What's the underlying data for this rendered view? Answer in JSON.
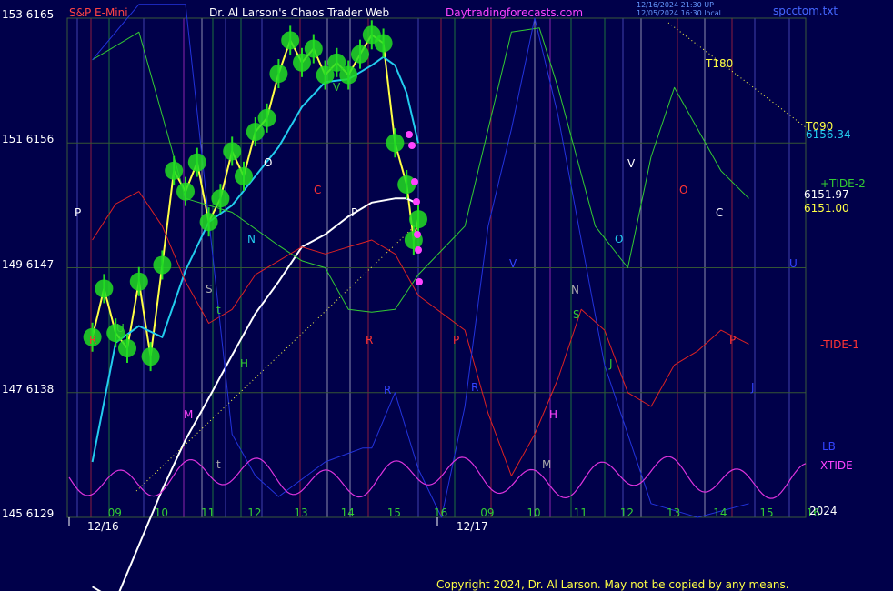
{
  "header": {
    "instrument": "S&P E-Mini",
    "site_title": "Dr. Al Larson's Chaos Trader Web",
    "site_url": "Daytradingforecasts.com",
    "stamp_line1": "12/16/2024 21:30 UP",
    "stamp_line2": "12/05/2024 16:30 local",
    "file_name": "spcctom.txt"
  },
  "copyright": "Copyright 2024, Dr. Al Larson. May not be copied by any means.",
  "colors": {
    "background": "#00004a",
    "plot_frame": "#3a5a3a",
    "price_green": "#22dd22",
    "price_yellow": "#ffff44",
    "price_magenta": "#ff44ff",
    "ema_cyan": "#22ccee",
    "ema_white": "#ffffff",
    "tide_green": "#33cc33",
    "tide_red": "#dd2222",
    "blue_line": "#2233dd",
    "xtide_magenta": "#dd33dd"
  },
  "chart_data": {
    "type": "line",
    "title": "S&P E-Mini",
    "y_axis_left": {
      "labels": [
        "153 6165",
        "151 6156",
        "149 6147",
        "147 6138",
        "145 6129"
      ],
      "ylim": [
        6129,
        6165
      ]
    },
    "x_axis": {
      "hour_ticks": [
        "09",
        "10",
        "11",
        "12",
        "13",
        "14",
        "15",
        "16",
        "09",
        "10",
        "11",
        "12",
        "13",
        "14",
        "15",
        "16"
      ],
      "date_labels": [
        "12/16",
        "12/17"
      ],
      "year": "2024"
    },
    "right_labels": {
      "t090": "T090",
      "t090_value": "6156.34",
      "tide_plus2": "+TIDE-2",
      "value_a": "6151.97",
      "value_b": "6151.00",
      "tide_minus1": "-TIDE-1",
      "lb": "LB",
      "xtide": "XTIDE"
    },
    "annotations": {
      "t180": "T180",
      "letters": [
        "P",
        "R",
        "M",
        "S",
        "t",
        "H",
        "N",
        "C",
        "O",
        "P",
        "R",
        "P",
        "R",
        "V",
        "O",
        "N",
        "S",
        "J",
        "H",
        "M",
        "t",
        "O",
        "C",
        "P",
        "R",
        "V",
        "U",
        "U",
        "J",
        "V",
        "T180"
      ]
    },
    "series": [
      {
        "name": "S&P E-Mini",
        "x": [
          9.0,
          9.25,
          9.5,
          9.75,
          10.0,
          10.25,
          10.5,
          10.75,
          11.0,
          11.25,
          11.5,
          11.75,
          12.0,
          12.25,
          12.5,
          12.75,
          13.0,
          13.25,
          13.5,
          13.75,
          14.0,
          14.25,
          14.5,
          14.75,
          15.0,
          15.25,
          15.5,
          15.75,
          15.9,
          16.0
        ],
        "values": [
          6142.0,
          6145.5,
          6142.3,
          6141.2,
          6146.0,
          6140.6,
          6147.2,
          6154.0,
          6152.5,
          6154.6,
          6150.3,
          6152.0,
          6155.4,
          6153.6,
          6156.8,
          6157.8,
          6161.0,
          6163.4,
          6161.8,
          6162.8,
          6160.9,
          6161.8,
          6160.9,
          6162.4,
          6163.8,
          6163.2,
          6156.0,
          6153.0,
          6149.0,
          6150.5
        ]
      },
      {
        "name": "EMA fast",
        "x": [
          9.0,
          9.5,
          10.0,
          10.5,
          11.0,
          11.5,
          12.0,
          12.5,
          13.0,
          13.5,
          14.0,
          14.5,
          15.0,
          15.25,
          15.5,
          15.75,
          16.0
        ],
        "values": [
          6133.0,
          6141.6,
          6142.8,
          6142.0,
          6146.8,
          6150.3,
          6151.5,
          6153.6,
          6155.7,
          6158.6,
          6160.4,
          6160.6,
          6161.6,
          6162.2,
          6161.6,
          6159.6,
          6156.0
        ]
      },
      {
        "name": "EMA slow",
        "x": [
          9.0,
          9.5,
          10.0,
          10.5,
          11.0,
          11.5,
          12.0,
          12.5,
          13.0,
          13.5,
          14.0,
          14.5,
          15.0,
          15.5,
          15.75,
          16.0
        ],
        "values": [
          6124.0,
          6123.0,
          6127.0,
          6131.0,
          6134.6,
          6137.6,
          6140.7,
          6143.7,
          6146.0,
          6148.5,
          6149.4,
          6150.7,
          6151.7,
          6152.0,
          6152.0,
          6151.6
        ]
      },
      {
        "name": "+TIDE-2",
        "x": [
          9.0,
          10.0,
          11.0,
          12.0,
          13.0,
          13.5,
          14.0,
          14.5,
          15.0,
          15.5,
          16.0,
          17.0,
          18.0,
          18.6,
          19.0,
          19.8,
          20.5,
          21.0,
          21.5,
          22.0,
          22.5,
          23.1
        ],
        "values": [
          6162.0,
          6164.0,
          6152.0,
          6151.0,
          6148.6,
          6147.5,
          6147.0,
          6144.0,
          6143.8,
          6144.0,
          6146.5,
          6150.0,
          6164.0,
          6164.3,
          6160.0,
          6150.0,
          6147.0,
          6155.0,
          6160.0,
          6157.0,
          6154.0,
          6152.0
        ]
      },
      {
        "name": "-TIDE-1",
        "x": [
          9.0,
          9.5,
          10.0,
          10.5,
          11.0,
          11.5,
          12.0,
          12.5,
          13.0,
          13.5,
          14.0,
          14.5,
          15.0,
          15.5,
          16.0,
          17.0,
          17.5,
          18.0,
          18.5,
          19.0,
          19.5,
          20.0,
          20.5,
          21.0,
          21.5,
          22.0,
          22.5,
          23.1
        ],
        "values": [
          6149.0,
          6151.6,
          6152.5,
          6150.0,
          6146.0,
          6143.0,
          6144.0,
          6146.5,
          6147.5,
          6148.5,
          6148.0,
          6148.5,
          6149.0,
          6148.0,
          6145.0,
          6142.5,
          6136.5,
          6132.0,
          6135.0,
          6139.0,
          6144.0,
          6142.5,
          6138.0,
          6137.0,
          6140.0,
          6141.0,
          6142.5,
          6141.5
        ]
      },
      {
        "name": "LB",
        "x": [
          9.0,
          10.0,
          11.0,
          12.0,
          12.5,
          13.0,
          14.0,
          14.8,
          15.0,
          15.5,
          16.0,
          16.5,
          17.0,
          17.5,
          18.0,
          18.5,
          19.0,
          20.0,
          21.0,
          22.0,
          23.1
        ],
        "values": [
          6162.0,
          6166.0,
          6166.0,
          6135.0,
          6132.0,
          6130.5,
          6133.0,
          6134.0,
          6134.0,
          6138.0,
          6132.5,
          6129.0,
          6137.0,
          6150.0,
          6157.0,
          6165.0,
          6158.0,
          6140.0,
          6130.0,
          6129.0,
          6130.0
        ]
      }
    ]
  }
}
